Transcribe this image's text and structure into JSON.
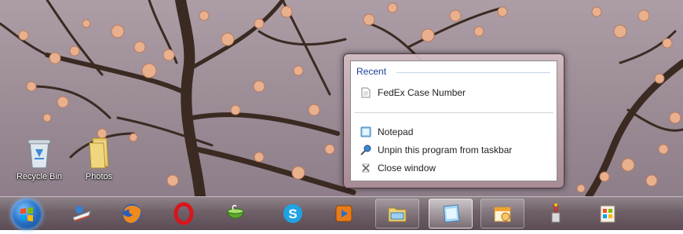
{
  "desktop": {
    "icons": [
      {
        "label": "Recycle Bin"
      },
      {
        "label": "Photos"
      }
    ]
  },
  "jumplist": {
    "section_title": "Recent",
    "recent_items": [
      {
        "label": "FedEx Case Number",
        "icon": "text-document-icon"
      }
    ],
    "tasks": [
      {
        "label": "Notepad",
        "icon": "notepad-icon"
      },
      {
        "label": "Unpin this program from taskbar",
        "icon": "unpin-icon"
      },
      {
        "label": "Close window",
        "icon": "close-window-icon"
      }
    ]
  },
  "taskbar": {
    "buttons": [
      {
        "icon": "start-orb",
        "state": "normal"
      },
      {
        "icon": "fedex-app-icon",
        "state": "normal"
      },
      {
        "icon": "firefox-icon",
        "state": "normal"
      },
      {
        "icon": "opera-icon",
        "state": "normal"
      },
      {
        "icon": "cauldron-app-icon",
        "state": "normal"
      },
      {
        "icon": "skype-icon",
        "state": "normal"
      },
      {
        "icon": "media-player-icon",
        "state": "normal"
      },
      {
        "icon": "file-explorer-icon",
        "state": "normal"
      },
      {
        "icon": "notepad-icon",
        "state": "active"
      },
      {
        "icon": "calendar-app-icon",
        "state": "normal"
      },
      {
        "icon": "paint-tool-icon",
        "state": "normal"
      },
      {
        "icon": "windows-app-icon",
        "state": "normal"
      }
    ]
  },
  "colors": {
    "jumplist_header": "#1e3f9a",
    "blossom": "#e9b08e",
    "branch": "#3a2a22"
  }
}
